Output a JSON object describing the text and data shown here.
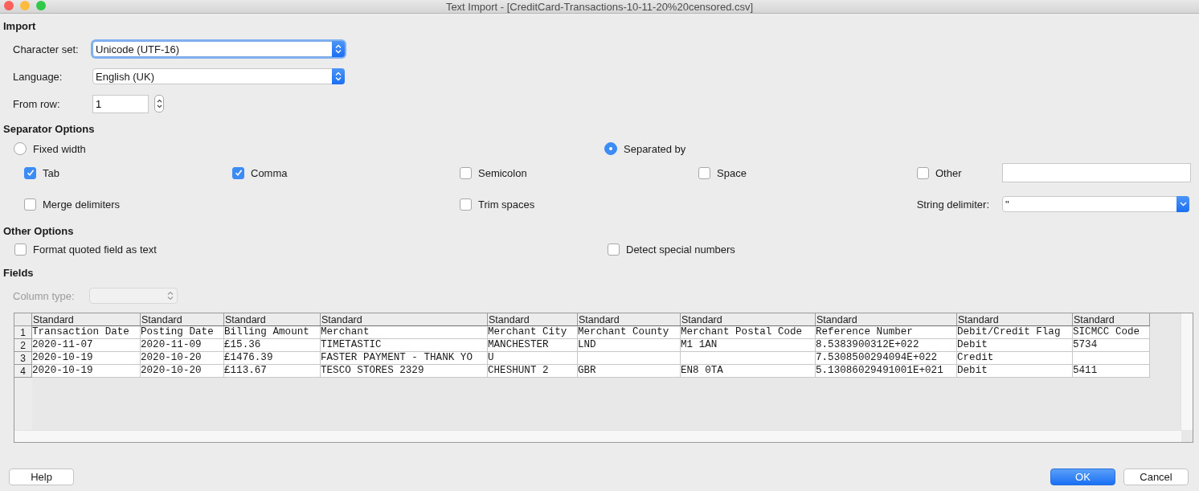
{
  "window": {
    "title": "Text Import - [CreditCard-Transactions-10-11-20%20censored.csv]"
  },
  "import": {
    "heading": "Import",
    "character_set": {
      "label": "Character set:",
      "value": "Unicode (UTF-16)",
      "focused": true
    },
    "language": {
      "label": "Language:",
      "value": "English (UK)"
    },
    "from_row": {
      "label": "From row:",
      "value": "1"
    }
  },
  "separator_options": {
    "heading": "Separator Options",
    "modes": [
      {
        "label": "Fixed width",
        "selected": false
      },
      {
        "label": "Separated by",
        "selected": true
      }
    ],
    "separators": [
      {
        "label": "Tab",
        "checked": true
      },
      {
        "label": "Comma",
        "checked": true
      },
      {
        "label": "Semicolon",
        "checked": false
      },
      {
        "label": "Space",
        "checked": false
      },
      {
        "label": "Other",
        "checked": false
      },
      {
        "label": "Merge delimiters",
        "checked": false
      },
      {
        "label": "Trim spaces",
        "checked": false
      }
    ],
    "string_delimiter": {
      "label": "String delimiter:",
      "value": "\""
    }
  },
  "other_options": {
    "heading": "Other Options",
    "options": [
      {
        "label": "Format quoted field as text",
        "checked": false
      },
      {
        "label": "Detect special numbers",
        "checked": false
      }
    ]
  },
  "fields": {
    "heading": "Fields",
    "column_type": {
      "label": "Column type:",
      "disabled": true
    },
    "table": {
      "columns": [
        "Standard",
        "Standard",
        "Standard",
        "Standard",
        "Standard",
        "Standard",
        "Standard",
        "Standard",
        "Standard",
        "Standard"
      ],
      "rows": [
        {
          "number": "1",
          "cells": [
            "Transaction Date",
            "Posting Date",
            "Billing Amount",
            "Merchant",
            "Merchant City",
            "Merchant County",
            "Merchant Postal Code",
            "Reference Number",
            "Debit/Credit Flag",
            "SICMCC Code"
          ]
        },
        {
          "number": "2",
          "cells": [
            "2020-11-07",
            "2020-11-09",
            "£15.36",
            "TIMETASTIC",
            "MANCHESTER",
            "LND",
            "M1 1AN",
            "8.5383900312E+022",
            "Debit",
            "5734"
          ]
        },
        {
          "number": "3",
          "cells": [
            "2020-10-19",
            "2020-10-20",
            "£1476.39",
            "FASTER PAYMENT - THANK YO",
            "U",
            null,
            null,
            "7.5308500294094E+022",
            "Credit",
            null
          ]
        },
        {
          "number": "4",
          "cells": [
            "2020-10-19",
            "2020-10-20",
            "£113.67",
            "TESCO STORES 2329",
            "CHESHUNT 2",
            "GBR",
            "EN8 0TA",
            "5.13086029491001E+021",
            "Debit",
            "5411"
          ]
        }
      ]
    }
  },
  "buttons": [
    {
      "label": "Help",
      "default": false
    },
    {
      "label": "OK",
      "default": true
    },
    {
      "label": "Cancel",
      "default": false
    }
  ]
}
